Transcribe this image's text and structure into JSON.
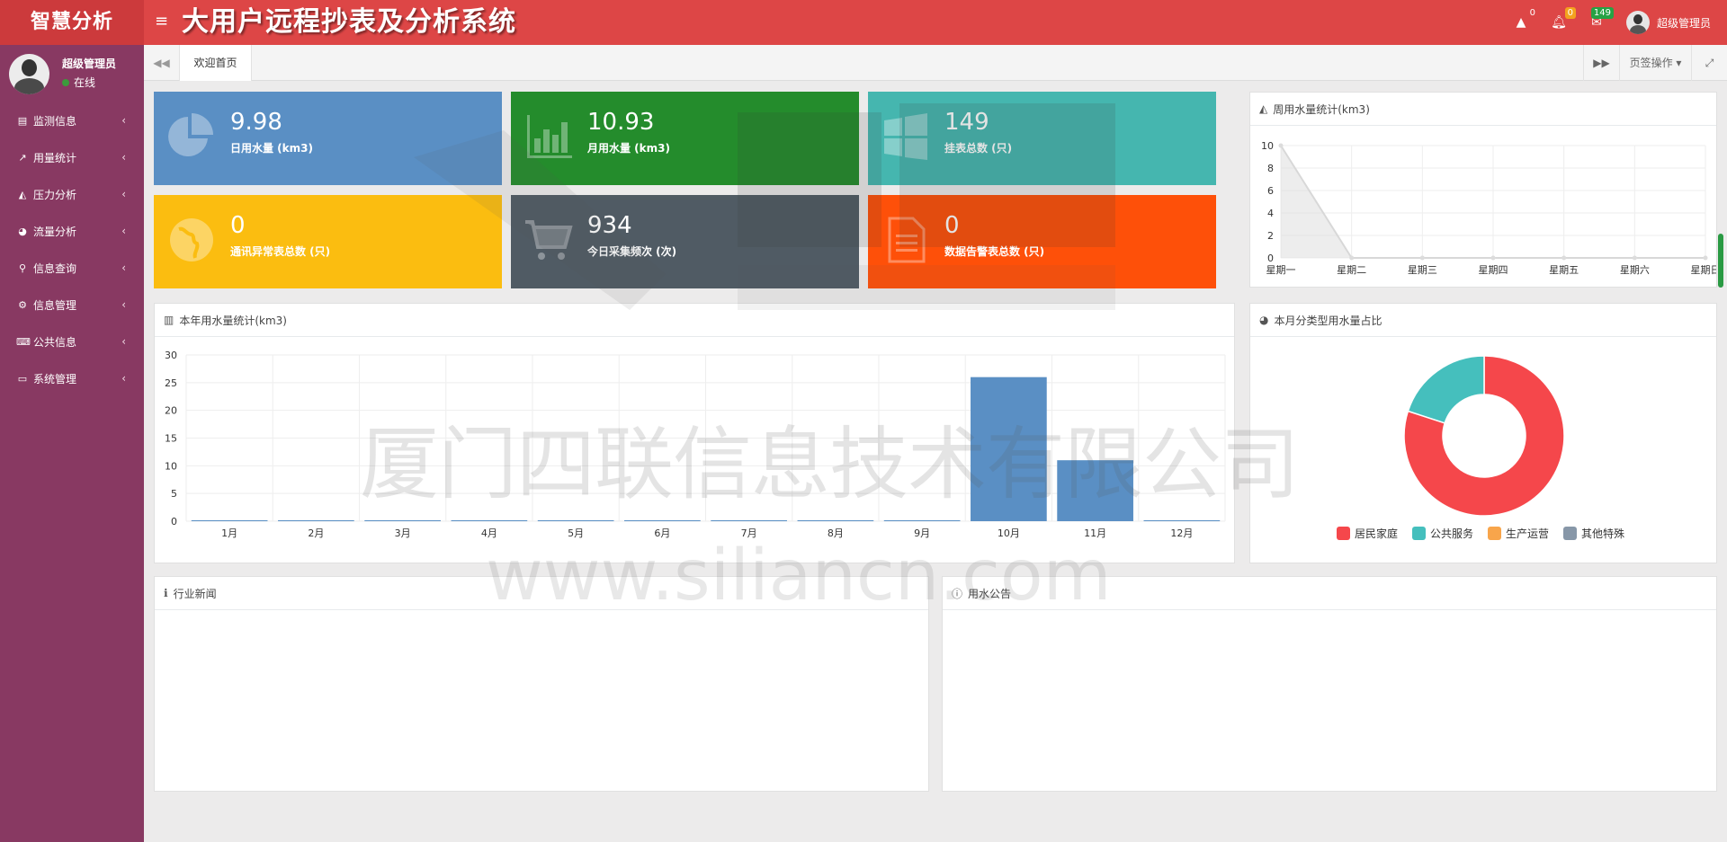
{
  "header": {
    "brand": "智慧分析",
    "title": "大用户远程抄表及分析系统",
    "alerts": {
      "warning": "0",
      "bell": "0",
      "mail": "149"
    },
    "user_name": "超级管理员",
    "colors": {
      "header": "#dd4646",
      "brand_bg": "#cc3a3c"
    }
  },
  "sidebar": {
    "user_name": "超级管理员",
    "status": "在线",
    "items": [
      {
        "label": "监测信息",
        "icon": "book-icon"
      },
      {
        "label": "用量统计",
        "icon": "line-chart-icon"
      },
      {
        "label": "压力分析",
        "icon": "area-chart-icon"
      },
      {
        "label": "流量分析",
        "icon": "pie-chart-icon"
      },
      {
        "label": "信息查询",
        "icon": "search-icon"
      },
      {
        "label": "信息管理",
        "icon": "gears-icon"
      },
      {
        "label": "公共信息",
        "icon": "keyboard-icon"
      },
      {
        "label": "系统管理",
        "icon": "desktop-icon"
      }
    ]
  },
  "tabs": {
    "active": "欢迎首页",
    "page_ops": "页签操作"
  },
  "tiles": [
    {
      "value": "9.98",
      "label": "日用水量 (km3)",
      "color": "#5a8fc4",
      "icon": "pie-chart-icon"
    },
    {
      "value": "10.93",
      "label": "月用水量 (km3)",
      "color": "#248c2c",
      "icon": "bar-chart-icon"
    },
    {
      "value": "149",
      "label": "挂表总数 (只)",
      "color": "#45b6af",
      "icon": "windows-icon"
    },
    {
      "value": "0",
      "label": "通讯异常表总数 (只)",
      "color": "#fbbd10",
      "icon": "globe-icon"
    },
    {
      "value": "934",
      "label": "今日采集频次 (次)",
      "color": "#505b64",
      "icon": "cart-icon"
    },
    {
      "value": "0",
      "label": "数据告警表总数 (只)",
      "color": "#fe5009",
      "icon": "file-icon"
    }
  ],
  "panels": {
    "weekly": {
      "title": "周用水量统计(km3)"
    },
    "yearly": {
      "title": "本年用水量统计(km3)"
    },
    "share": {
      "title": "本月分类型用水量占比"
    },
    "news": {
      "title": "行业新闻"
    },
    "notice": {
      "title": "用水公告"
    }
  },
  "watermark": {
    "company": "厦门四联信息技术有限公司",
    "url": "www.siliancn.com"
  },
  "chart_data": [
    {
      "type": "area",
      "title": "周用水量统计(km3)",
      "categories": [
        "星期一",
        "星期二",
        "星期三",
        "星期四",
        "星期五",
        "星期六",
        "星期日"
      ],
      "values": [
        10,
        0,
        0,
        0,
        0,
        0,
        0
      ],
      "ylim": [
        0,
        10
      ],
      "yticks": [
        0,
        2,
        4,
        6,
        8,
        10
      ],
      "grid": true
    },
    {
      "type": "bar",
      "title": "本年用水量统计(km3)",
      "categories": [
        "1月",
        "2月",
        "3月",
        "4月",
        "5月",
        "6月",
        "7月",
        "8月",
        "9月",
        "10月",
        "11月",
        "12月"
      ],
      "values": [
        0,
        0,
        0,
        0,
        0,
        0,
        0,
        0,
        0,
        26,
        11,
        0
      ],
      "ylim": [
        0,
        30
      ],
      "yticks": [
        0,
        5,
        10,
        15,
        20,
        25,
        30
      ],
      "color": "#5a8fc4",
      "grid": true
    },
    {
      "type": "pie",
      "title": "本月分类型用水量占比",
      "legend_position": "bottom",
      "series": [
        {
          "name": "居民家庭",
          "value": 80,
          "color": "#f5474b"
        },
        {
          "name": "公共服务",
          "value": 20,
          "color": "#45bfbd"
        },
        {
          "name": "生产运营",
          "value": 0,
          "color": "#f8a54b"
        },
        {
          "name": "其他特殊",
          "value": 0,
          "color": "#8797a8"
        }
      ]
    }
  ]
}
